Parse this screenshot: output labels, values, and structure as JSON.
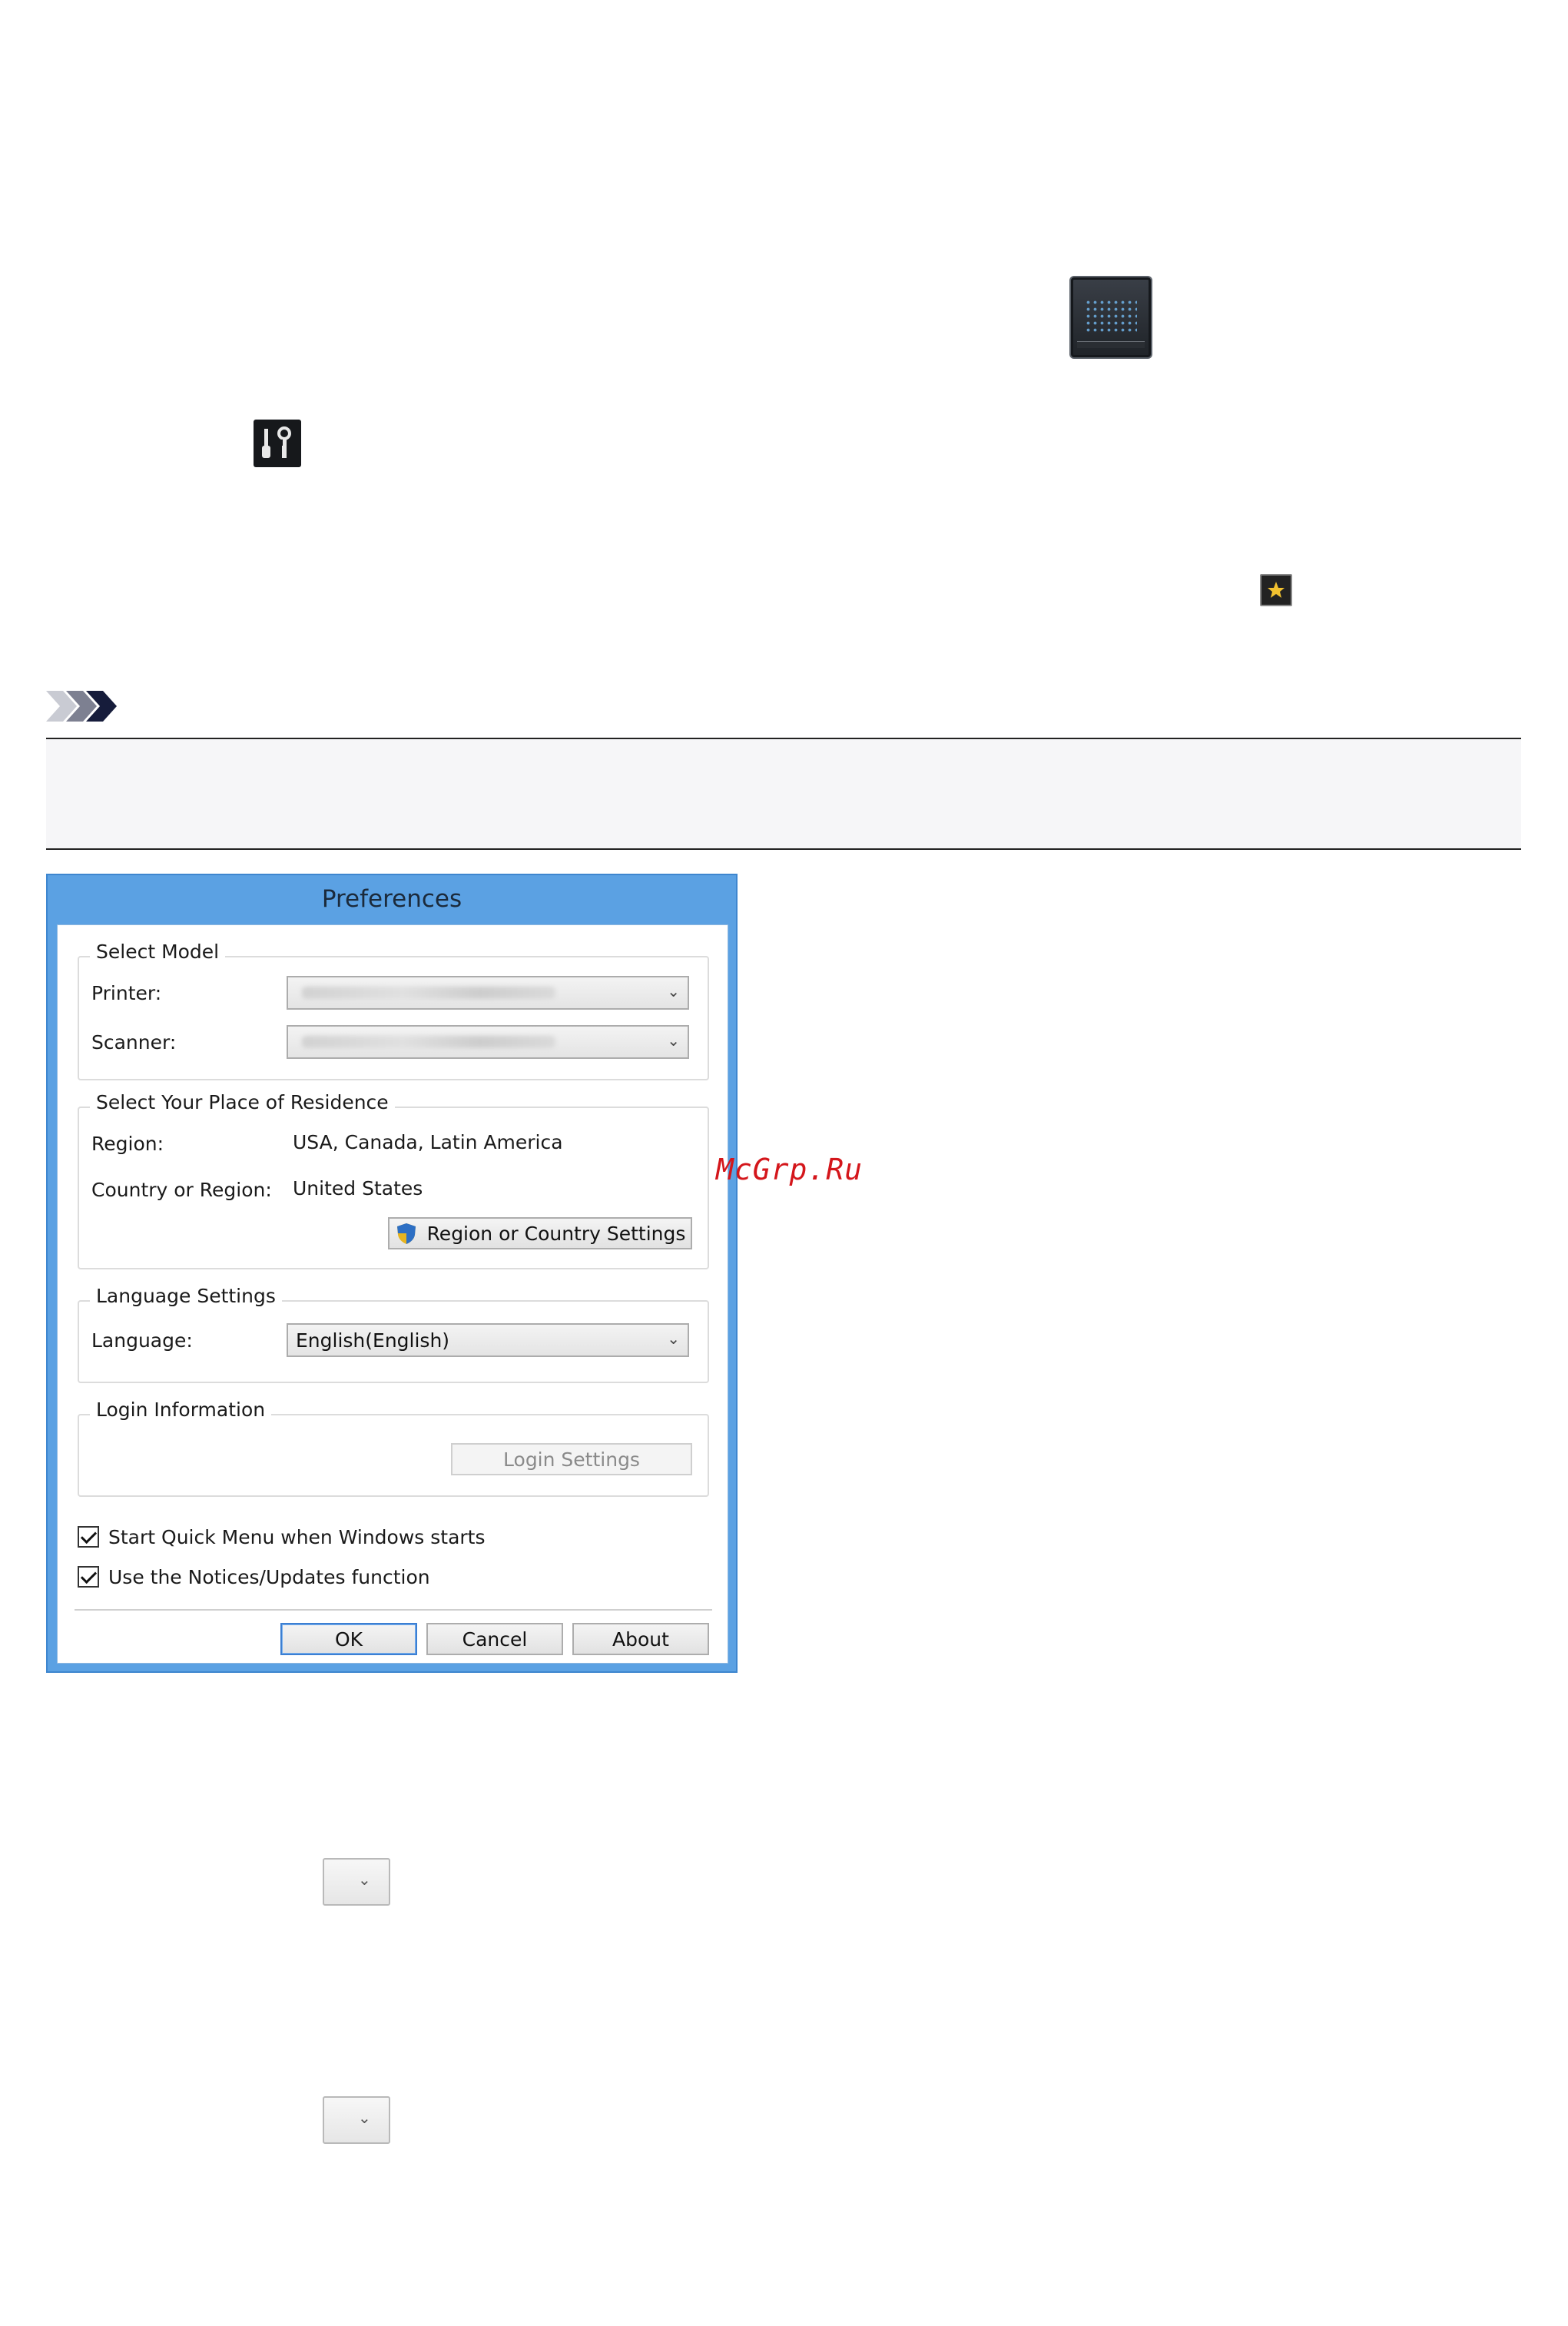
{
  "icons": {
    "quick_menu": "quick-menu-icon",
    "tools": "tools-icon",
    "favorite": "favorite-icon",
    "note": "note-icon",
    "shield": "shield-icon"
  },
  "colors": {
    "dialog_frame": "#5ba1e3",
    "watermark": "#d4161b"
  },
  "dialog": {
    "title": "Preferences",
    "select_model": {
      "legend": "Select Model",
      "printer_label": "Printer:",
      "scanner_label": "Scanner:"
    },
    "residence": {
      "legend": "Select Your Place of Residence",
      "region_label": "Region:",
      "region_value": "USA, Canada, Latin America",
      "country_label": "Country or Region:",
      "country_value": "United States",
      "settings_button": "Region or Country Settings"
    },
    "language": {
      "legend": "Language Settings",
      "label": "Language:",
      "value": "English(English)"
    },
    "login": {
      "legend": "Login Information",
      "button": "Login Settings"
    },
    "checkboxes": {
      "quick_menu": "Start Quick Menu when Windows starts",
      "notices": "Use the Notices/Updates function"
    },
    "buttons": {
      "ok": "OK",
      "cancel": "Cancel",
      "about": "About"
    }
  },
  "watermark": "McGrp.Ru"
}
